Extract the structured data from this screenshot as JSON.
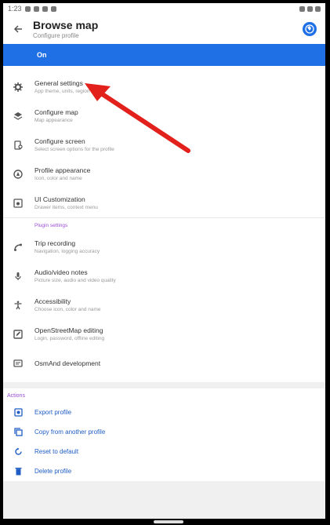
{
  "status": {
    "time": "1:23"
  },
  "toolbar": {
    "title": "Browse map",
    "subtitle": "Configure profile"
  },
  "state_bar": {
    "label": "On"
  },
  "settings": [
    {
      "title": "General settings",
      "subtitle": "App theme, units, region",
      "icon": "gear-icon"
    },
    {
      "title": "Configure map",
      "subtitle": "Map appearance",
      "icon": "layers-icon"
    },
    {
      "title": "Configure screen",
      "subtitle": "Select screen options for the profile",
      "icon": "screen-icon"
    },
    {
      "title": "Profile appearance",
      "subtitle": "Icon, color and name",
      "icon": "palette-icon"
    },
    {
      "title": "UI Customization",
      "subtitle": "Drawer items, context menu",
      "icon": "ui-icon"
    }
  ],
  "plugin_header": "Plugin settings",
  "plugins": [
    {
      "title": "Trip recording",
      "subtitle": "Navigation, logging accuracy",
      "icon": "trip-icon"
    },
    {
      "title": "Audio/video notes",
      "subtitle": "Picture size, audio and video quality",
      "icon": "mic-icon"
    },
    {
      "title": "Accessibility",
      "subtitle": "Choose icon, color and name",
      "icon": "accessibility-icon"
    },
    {
      "title": "OpenStreetMap editing",
      "subtitle": "Login, password, offline editing",
      "icon": "osm-icon"
    },
    {
      "title": "OsmAnd development",
      "subtitle": "",
      "icon": "dev-icon"
    }
  ],
  "actions_header": "Actions",
  "actions": [
    {
      "label": "Export profile",
      "icon": "export-icon"
    },
    {
      "label": "Copy from another profile",
      "icon": "copy-icon"
    },
    {
      "label": "Reset to default",
      "icon": "reset-icon"
    },
    {
      "label": "Delete profile",
      "icon": "delete-icon"
    }
  ],
  "colors": {
    "accent": "#1f6fe5",
    "plugin_header": "#9b4dd6",
    "annotation_arrow": "#e3211c"
  }
}
